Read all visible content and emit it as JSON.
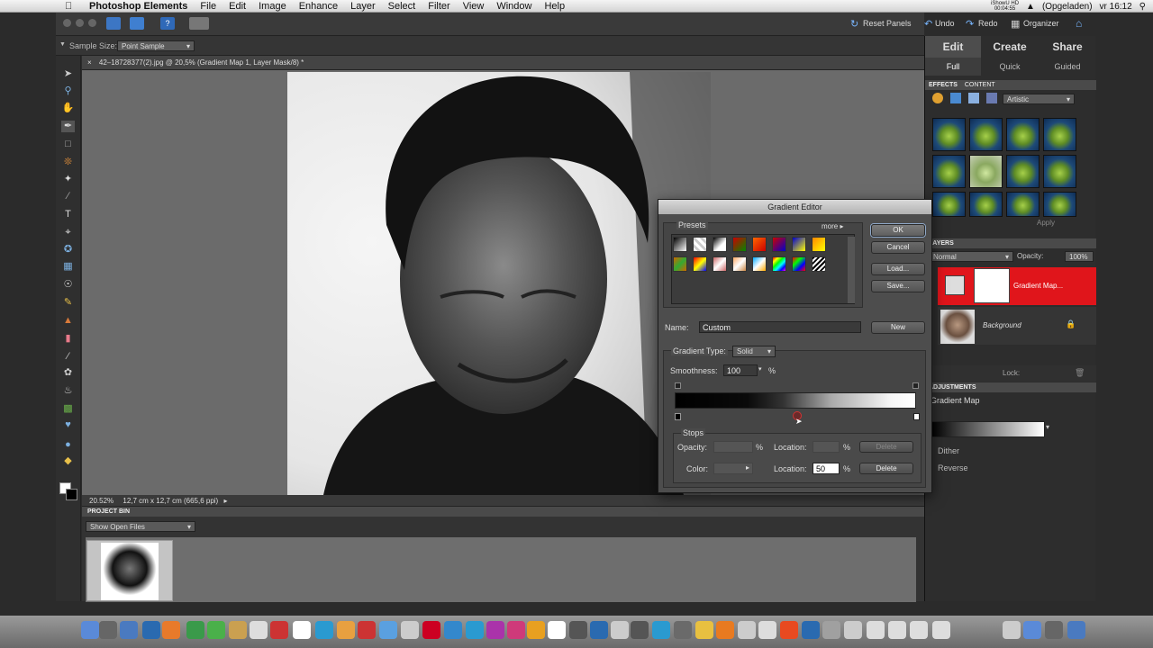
{
  "menubar": {
    "apple": "",
    "app_name": "Photoshop Elements",
    "items": [
      "File",
      "Edit",
      "Image",
      "Enhance",
      "Layer",
      "Select",
      "Filter",
      "View",
      "Window",
      "Help"
    ],
    "status_tiny": "iShowU HD",
    "status_time": "00:04:55",
    "battery": "(Opgeladen)",
    "clock": "vr 16:12"
  },
  "topbar": {
    "reset_panels": "Reset Panels",
    "undo": "Undo",
    "redo": "Redo",
    "organizer": "Organizer"
  },
  "tool_options": {
    "sample_size_label": "Sample Size:",
    "sample_size_value": "Point Sample"
  },
  "document": {
    "tab_title": "42–18728377(2).jpg @ 20,5% (Gradient Map 1, Layer Mask/8) *",
    "zoom": "20.52%",
    "doc_size": "12,7 cm x 12,7 cm (665,6 ppi)"
  },
  "project_bin": {
    "header": "PROJECT BIN",
    "dropdown": "Show Open Files"
  },
  "panel": {
    "tabs": [
      "Edit",
      "Create",
      "Share"
    ],
    "subtabs": [
      "Full",
      "Quick",
      "Guided"
    ],
    "effects_tabs": [
      "EFFECTS",
      "CONTENT"
    ],
    "effects_dropdown": "Artistic",
    "apply": "Apply",
    "layers_header": "LAYERS",
    "blend_mode": "Normal",
    "opacity_label": "Opacity:",
    "opacity_value": "100%",
    "layer1": "Gradient Map...",
    "layer2": "Background",
    "lock_label": "Lock:",
    "adjust_header": "ADJUSTMENTS",
    "adjust_title": "Gradient Map",
    "dither": "Dither",
    "reverse": "Reverse"
  },
  "dialog": {
    "title": "Gradient Editor",
    "presets_label": "Presets",
    "more": "more",
    "ok": "OK",
    "cancel": "Cancel",
    "load": "Load...",
    "save": "Save...",
    "name_label": "Name:",
    "name_value": "Custom",
    "new": "New",
    "gradient_type_label": "Gradient Type:",
    "gradient_type_value": "Solid",
    "smoothness_label": "Smoothness:",
    "smoothness_value": "100",
    "pct": "%",
    "stops_label": "Stops",
    "opacity_label": "Opacity:",
    "location_label": "Location:",
    "delete": "Delete",
    "color_label": "Color:",
    "location_value": "50"
  },
  "colors": {
    "layer_selected": "#e0151b",
    "accent": "#8fa8c8"
  }
}
